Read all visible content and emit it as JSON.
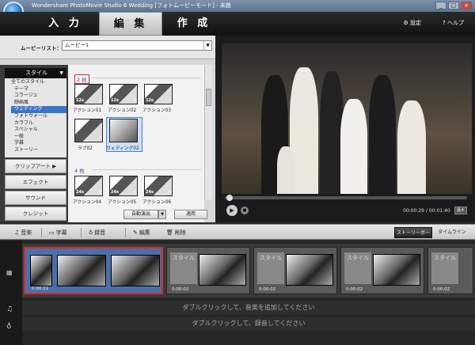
{
  "window": {
    "title": "Wondershare PhotoMovie Studio 6 Wedding [フォトムービーモード] - 未題"
  },
  "tabs": {
    "input": "入 力",
    "edit": "編 集",
    "make": "作 成"
  },
  "header": {
    "settings": "設定",
    "help": "ヘルプ",
    "settings_icon": "gear-icon",
    "help_icon": "question-icon"
  },
  "movielist": {
    "label": "ムービーリスト：",
    "value": "ムービー1"
  },
  "style_panel": {
    "head": "スタイル",
    "items": [
      "全てのスタイル",
      "テーマ",
      "コラージュ",
      "映画風",
      "ウェディング",
      "フォトウォール",
      "カラフル",
      "スペシャル",
      "一般",
      "字幕",
      "ストーリー"
    ],
    "selected_index": 4
  },
  "categories": {
    "clipart": "クリップアート",
    "effect": "エフェクト",
    "sound": "サウンド",
    "credit": "クレジット"
  },
  "thumbs": {
    "group2": "2 枚",
    "group4": "4 枚",
    "row1": [
      {
        "label": "アクション01",
        "n": "12s",
        "c": "2"
      },
      {
        "label": "アクション02",
        "n": "12s",
        "c": "2"
      },
      {
        "label": "アクション03",
        "n": "12s",
        "c": "2"
      }
    ],
    "row2": [
      {
        "label": "ラブ02",
        "n": "",
        "c": "2"
      },
      {
        "label": "ウェディング02",
        "n": "",
        "c": ""
      }
    ],
    "row3": [
      {
        "label": "アクション04",
        "n": "24s",
        "c": "4"
      },
      {
        "label": "アクション05",
        "n": "24s",
        "c": "4"
      },
      {
        "label": "アクション06",
        "n": "24s",
        "c": "4"
      }
    ]
  },
  "actions": {
    "auto": "自動演出",
    "apply": "適用"
  },
  "player": {
    "time": "00:00:29 / 00:01:40",
    "fullscreen": "最大"
  },
  "toolbar": {
    "music": "音楽",
    "caption": "字幕",
    "record": "録音",
    "edit": "編集",
    "delete": "削除",
    "storyboard": "ストーリーボード",
    "timeline": "タイムライン"
  },
  "clips": [
    {
      "duration": "0:00:11",
      "type": "photo"
    },
    {
      "duration": "0:00:02",
      "type": "style",
      "style_label": "スタイル"
    },
    {
      "duration": "0:00:02",
      "type": "style",
      "style_label": "スタイル"
    },
    {
      "duration": "0:00:02",
      "type": "style",
      "style_label": "スタイル"
    },
    {
      "duration": "0:00:02",
      "type": "style",
      "style_label": "スタイル"
    }
  ],
  "tracks": {
    "music_hint": "ダブルクリックして、音楽を追加してください",
    "record_hint": "ダブルクリックして、録音してください"
  }
}
